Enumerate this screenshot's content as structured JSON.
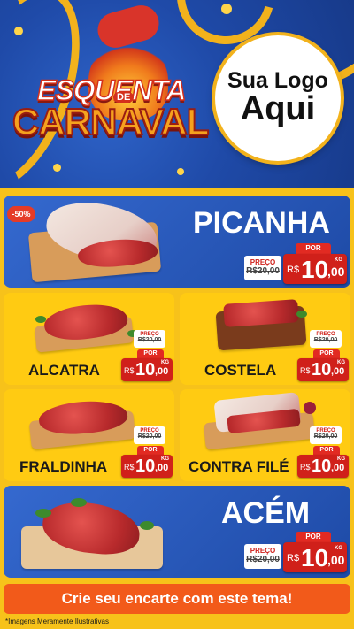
{
  "header": {
    "logo_esquenta": "ESQUENTA",
    "logo_de": "DE",
    "logo_carnaval": "CARNAVAL",
    "logo_placeholder_line1": "Sua Logo",
    "logo_placeholder_line2": "Aqui"
  },
  "featured": {
    "discount_badge": "-50%",
    "name": "PICANHA",
    "price_label": "PREÇO",
    "old_price": "R$20,00",
    "por_label": "POR",
    "currency": "R$",
    "price_int": "10",
    "price_dec": ",00",
    "unit": "KG"
  },
  "products": [
    {
      "name": "ALCATRA",
      "price_label": "PREÇO",
      "old_price": "R$20,00",
      "por_label": "POR",
      "currency": "R$",
      "price_int": "10",
      "price_dec": ",00",
      "unit": "KG"
    },
    {
      "name": "COSTELA",
      "price_label": "PREÇO",
      "old_price": "R$20,00",
      "por_label": "POR",
      "currency": "R$",
      "price_int": "10",
      "price_dec": ",00",
      "unit": "KG"
    },
    {
      "name": "FRALDINHA",
      "price_label": "PREÇO",
      "old_price": "R$20,00",
      "por_label": "POR",
      "currency": "R$",
      "price_int": "10",
      "price_dec": ",00",
      "unit": "KG"
    },
    {
      "name": "CONTRA FILÉ",
      "price_label": "PREÇO",
      "old_price": "R$20,00",
      "por_label": "POR",
      "currency": "R$",
      "price_int": "10",
      "price_dec": ",00",
      "unit": "KG"
    }
  ],
  "bottom_featured": {
    "name": "ACÉM",
    "price_label": "PREÇO",
    "old_price": "R$20,00",
    "por_label": "POR",
    "currency": "R$",
    "price_int": "10",
    "price_dec": ",00",
    "unit": "KG"
  },
  "cta": "Crie seu encarte com este tema!",
  "footer_note": "*Imagens Meramente Ilustrativas",
  "colors": {
    "brand_blue": "#1f4aa8",
    "brand_yellow": "#ffcb12",
    "price_red": "#d0201a",
    "cta_orange": "#f25a1a"
  }
}
